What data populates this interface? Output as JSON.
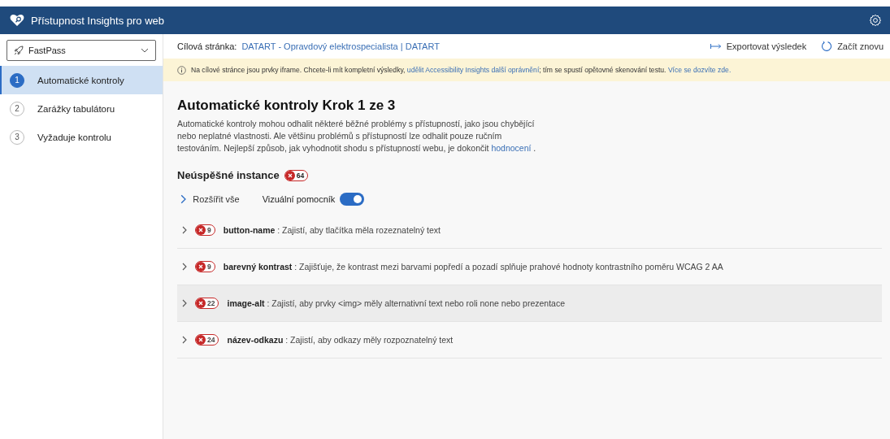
{
  "header": {
    "title": "Přístupnost Insights pro web"
  },
  "sidebar": {
    "dropdown": {
      "value": "FastPass"
    },
    "items": [
      {
        "number": "1",
        "label": "Automatické kontroly",
        "selected": true
      },
      {
        "number": "2",
        "label": "Zarážky tabulátoru",
        "selected": false
      },
      {
        "number": "3",
        "label": "Vyžaduje kontrolu",
        "selected": false
      }
    ]
  },
  "target_bar": {
    "label": "Cílová stránka:",
    "link": "DATART - Opravdový elektrospecialista | DATART",
    "actions": [
      {
        "kind": "export",
        "label": "Exportovat výsledek"
      },
      {
        "kind": "restart",
        "label": "Začít znovu"
      }
    ]
  },
  "banner": {
    "parts": [
      {
        "kind": "text",
        "text": "Na cílové stránce jsou prvky iframe. Chcete-li mít kompletní výsledky, "
      },
      {
        "kind": "link",
        "text": "udělit Accessibility Insights další oprávnění"
      },
      {
        "kind": "text",
        "text": "; tím se spustí opětovné skenování testu. "
      },
      {
        "kind": "link",
        "text": "Více se dozvíte zde."
      }
    ]
  },
  "content": {
    "title": "Automatické kontroly Krok 1 ze 3",
    "description": [
      {
        "kind": "text",
        "text": "Automatické kontroly mohou odhalit některé běžné problémy s přístupností, jako jsou chybějící nebo neplatné vlastnosti. Ale většinu problémů s přístupností lze odhalit pouze ručním testováním. Nejlepší způsob, jak vyhodnotit shodu s přístupností webu, je dokončit "
      },
      {
        "kind": "link",
        "text": "hodnocení"
      },
      {
        "kind": "text",
        "text": " ."
      }
    ],
    "failed_heading": "Neúspěšné instance",
    "failed_count": "64",
    "expand_all": "Rozšířit vše",
    "visual_helper": {
      "label": "Vizuální pomocník",
      "on": true
    },
    "rules": [
      {
        "count": "9",
        "name": "button-name",
        "description": " : Zajistí, aby tlačítka měla rozeznatelný text",
        "highlighted": false
      },
      {
        "count": "9",
        "name": "barevný kontrast",
        "description": " : Zajišťuje, že kontrast mezi barvami popředí a pozadí splňuje prahové hodnoty kontrastního poměru WCAG 2 AA",
        "highlighted": false
      },
      {
        "count": "22",
        "name": "image-alt",
        "description": " : Zajistí, aby prvky <img> měly alternativní text nebo roli none nebo prezentace",
        "highlighted": true
      },
      {
        "count": "24",
        "name": "název-odkazu",
        "description": " : Zajistí, aby odkazy měly rozpoznatelný text",
        "highlighted": false
      }
    ]
  }
}
